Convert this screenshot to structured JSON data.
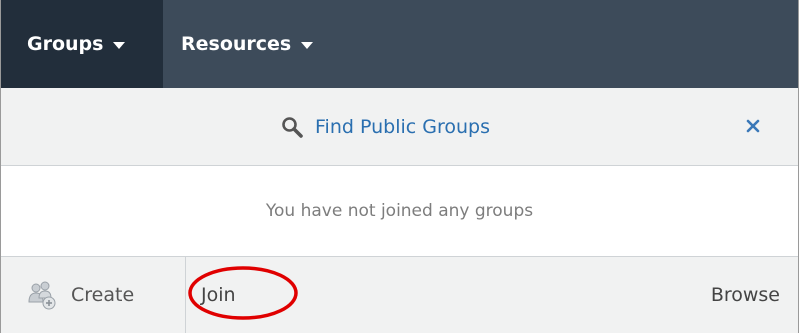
{
  "nav": {
    "items": [
      {
        "label": "Groups",
        "icon": "caret-down-icon"
      },
      {
        "label": "Resources",
        "icon": "caret-down-icon"
      }
    ]
  },
  "find": {
    "label": "Find Public Groups",
    "icon": "search-icon",
    "close_icon": "close-icon"
  },
  "empty_message": "You have not joined any groups",
  "footer": {
    "create": {
      "label": "Create",
      "icon": "group-add-icon"
    },
    "join": {
      "label": "Join"
    },
    "browse": {
      "label": "Browse"
    }
  },
  "colors": {
    "nav_bg": "#3d4b5a",
    "nav_active": "#222e3b",
    "link": "#2a6fb0",
    "annotation": "#e00000"
  }
}
